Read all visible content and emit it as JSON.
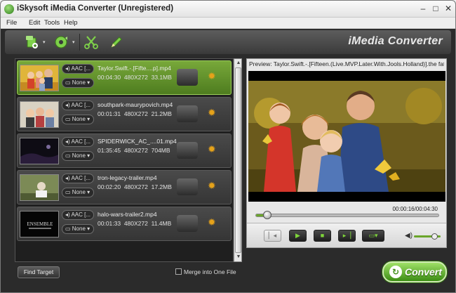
{
  "window": {
    "title": "iSkysoft iMedia Converter (Unregistered)",
    "controls": [
      "–",
      "□",
      "✕"
    ]
  },
  "menu": {
    "items": [
      "File",
      "Edit",
      "Tools",
      "Help"
    ]
  },
  "toolbar": {
    "brand": "iMedia Converter",
    "buttons": [
      {
        "icon": "add-file-icon",
        "color": "#6cbf3a"
      },
      {
        "icon": "load-dvd-icon",
        "color": "#6cbf3a"
      },
      {
        "icon": "scissors-icon",
        "color": "#6cbf3a"
      },
      {
        "icon": "pencil-icon",
        "color": "#6cbf3a"
      }
    ]
  },
  "files": [
    {
      "audio": "AAC [...",
      "subtitle": "None",
      "name": "Taylor.Swift.-.[Fifte....p].mp4",
      "duration": "00:04:30",
      "resolution": "480X272",
      "size": "33.1MB",
      "selected": true
    },
    {
      "audio": "AAC [...",
      "subtitle": "None",
      "name": "southpark-maurypovich.mp4",
      "duration": "00:01:31",
      "resolution": "480X272",
      "size": "21.2MB",
      "selected": false
    },
    {
      "audio": "AAC [...",
      "subtitle": "None",
      "name": "SPIDERWICK_AC_....01.mp4",
      "duration": "01:35:45",
      "resolution": "480X272",
      "size": "704MB",
      "selected": false
    },
    {
      "audio": "AAC [...",
      "subtitle": "None",
      "name": "tron-legacy-trailer.mp4",
      "duration": "00:02:20",
      "resolution": "480X272",
      "size": "17.2MB",
      "selected": false
    },
    {
      "audio": "AAC [...",
      "subtitle": "None",
      "name": "halo-wars-trailer2.mp4",
      "duration": "00:01:33",
      "resolution": "480X272",
      "size": "11.4MB",
      "selected": false
    }
  ],
  "thumb_text": {
    "halo": "ENSEMBLE"
  },
  "bottom": {
    "find_target": "Find Target",
    "merge_label": "Merge into One File"
  },
  "preview": {
    "title": "Preview: Taylor.Swift.-.[Fifteen.(Live.MVP.Later.With.Jools.Holland)].the  fatacti",
    "time_current": "00:00:16",
    "time_total": "00:04:30",
    "timecode": "00:00:16/00:04:30",
    "progress": 0.06,
    "volume": 0.75
  },
  "convert": {
    "label": "Convert"
  },
  "colors": {
    "accent_green": "#6aa52a",
    "gear": "#e5a21a"
  }
}
